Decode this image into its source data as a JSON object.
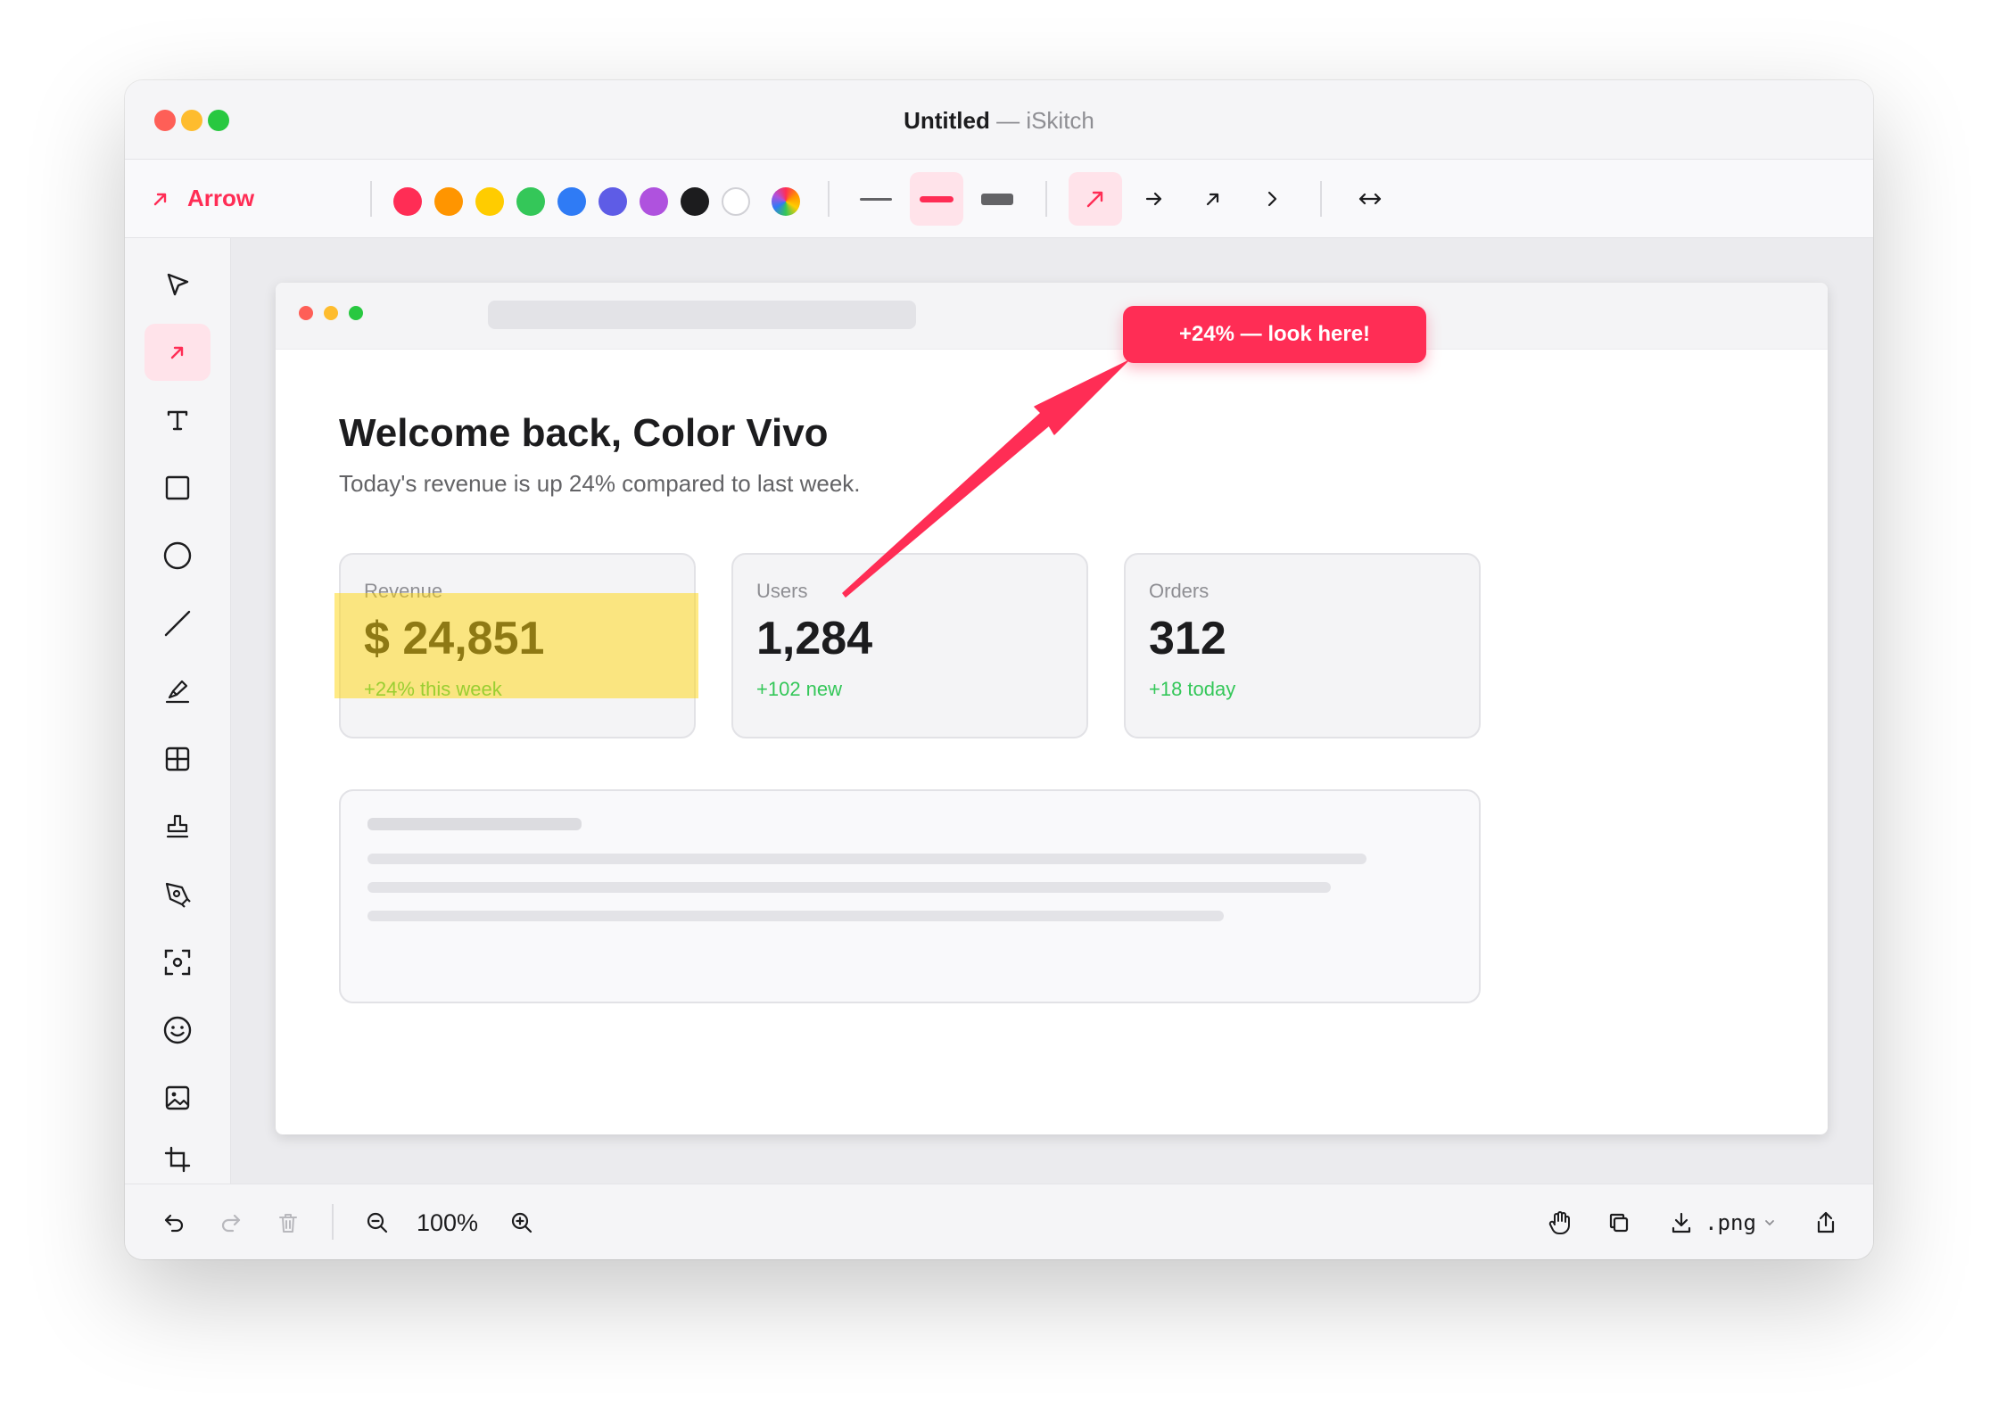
{
  "window": {
    "document_title": "Untitled",
    "app_title": "— iSkitch"
  },
  "toolbar": {
    "active_tool_label": "Arrow",
    "colors": [
      "#ff2d55",
      "#ff9500",
      "#ffcc00",
      "#34c759",
      "#2f7bf5",
      "#5e5ce6",
      "#af52de",
      "#1c1c1e",
      "#ffffff",
      "rainbow"
    ],
    "selected_stroke": "medium",
    "selected_arrow_style": "filled-head"
  },
  "sidebar": {
    "tools": [
      "select-tool",
      "arrow-tool",
      "text-tool",
      "rectangle-tool",
      "ellipse-tool",
      "line-tool",
      "highlighter-tool",
      "blur-grid-tool",
      "stamp-tool",
      "pen-tool",
      "screenshot-tool",
      "emoji-tool",
      "image-tool",
      "crop-tool"
    ],
    "active_tool": "arrow-tool",
    "current_color": "#ff2d55"
  },
  "doc": {
    "welcome": "Welcome back, Color Vivo",
    "subtitle": "Today's revenue is up 24% compared to last week.",
    "cards": [
      {
        "label": "Revenue",
        "value": "$ 24,851",
        "delta": "+24% this week"
      },
      {
        "label": "Users",
        "value": "1,284",
        "delta": "+102 new"
      },
      {
        "label": "Orders",
        "value": "312",
        "delta": "+18 today"
      }
    ]
  },
  "annotation": {
    "callout_text": "+24% — look here!"
  },
  "bottom": {
    "zoom": "100%",
    "export_format": ".png"
  }
}
